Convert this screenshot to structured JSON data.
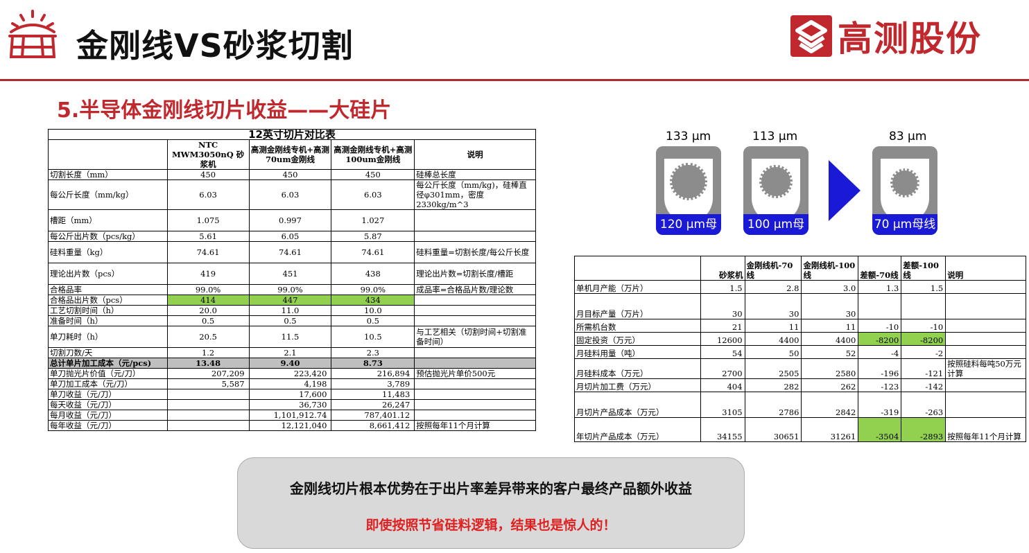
{
  "header": {
    "title": "金刚线VS砂浆切割",
    "company": "高测股份",
    "accent_color": "#c0282e",
    "logo_icon": "slide-deck-icon"
  },
  "subtitle": "5.半导体金刚线切片收益——大硅片",
  "left_table": {
    "title": "12英寸切片对比表",
    "headers": [
      "",
      "NTC MWM3050nQ 砂浆机",
      "高测金刚线专机+高测70um金刚线",
      "高测金刚线专机+高测100um金刚线",
      "说明"
    ],
    "rows": [
      [
        "切割长度（mm）",
        "450",
        "450",
        "450",
        "硅棒总长度"
      ],
      [
        "每公斤长度（mm/kg）",
        "6.03",
        "6.03",
        "6.03",
        "每公斤长度（mm/kg)，硅棒直径φ301mm，密度2330kg/m^3"
      ],
      [
        "槽距（mm）",
        "1.075",
        "0.997",
        "1.027",
        ""
      ],
      [
        "每公斤出片数（pcs/kg）",
        "5.61",
        "6.05",
        "5.87",
        ""
      ],
      [
        "硅料重量（kg）",
        "74.61",
        "74.61",
        "74.61",
        "硅料重量=切割长度/每公斤长度"
      ],
      [
        "理论出片数（pcs）",
        "419",
        "451",
        "438",
        "理论出片数=切割长度/槽距"
      ],
      [
        "合格品率",
        "99.0%",
        "99.0%",
        "99.0%",
        "成品率=合格品片数/理论数"
      ],
      [
        "合格品出片数（pcs）",
        "414",
        "447",
        "434",
        ""
      ],
      [
        "工艺切割时间（h）",
        "20.0",
        "11.0",
        "10.0",
        ""
      ],
      [
        "准备时间（h）",
        "0.5",
        "0.5",
        "0.5",
        ""
      ],
      [
        "单刀耗时（h）",
        "20.5",
        "11.5",
        "10.5",
        "与工艺相关（切割时间+切割准备时间）"
      ],
      [
        "切割刀数/天",
        "1.2",
        "2.1",
        "2.3",
        ""
      ],
      [
        "总计单片加工成本（元/pcs)",
        "13.48",
        "9.40",
        "8.73",
        ""
      ],
      [
        "单刀抛光片价值（元/刀）",
        "207,209",
        "223,420",
        "216,894",
        "预估抛光片单价500元"
      ],
      [
        "单刀加工成本（元/刀）",
        "5,587",
        "4,198",
        "3,789",
        ""
      ],
      [
        "单刀收益（元/刀）",
        "",
        "17,600",
        "11,483",
        ""
      ],
      [
        "每天收益（元/刀）",
        "",
        "36,730",
        "26,247",
        ""
      ],
      [
        "每月收益（元/刀）",
        "",
        "1,101,912.74",
        "787,401.12",
        ""
      ],
      [
        "每年收益（元/刀）",
        "",
        "12,121,040",
        "8,661,412",
        "按照每年11个月计算"
      ]
    ]
  },
  "diagram": {
    "dims": [
      "133 µm",
      "113 µm",
      "83 µm"
    ],
    "labels": [
      "120 µm母线",
      "100 µm母线",
      "70 µm母线"
    ],
    "band_color": "#1a1ad6"
  },
  "right_table": {
    "headers": [
      "",
      "砂浆机",
      "金刚线机-70线",
      "金刚线机-100线",
      "差额-70线",
      "差额-100线",
      "说明"
    ],
    "rows": [
      [
        "单机月产能（万片）",
        "1.5",
        "2.8",
        "3.0",
        "1.3",
        "1.5",
        ""
      ],
      [
        "月目标产量（万片）",
        "30",
        "30",
        "30",
        "",
        "",
        ""
      ],
      [
        "所需机台数",
        "21",
        "11",
        "11",
        "-10",
        "-10",
        ""
      ],
      [
        "固定投资（万元）",
        "12600",
        "4400",
        "4400",
        "-8200",
        "-8200",
        ""
      ],
      [
        "月硅料用量（吨）",
        "54",
        "50",
        "52",
        "-4",
        "-2",
        ""
      ],
      [
        "月硅料成本（万元）",
        "2700",
        "2505",
        "2580",
        "-196",
        "-121",
        "按照硅料每吨50万元计算"
      ],
      [
        "月切片加工费（万元）",
        "404",
        "282",
        "262",
        "-123",
        "-142",
        ""
      ],
      [
        "月切片产品成本（万元）",
        "3105",
        "2786",
        "2842",
        "-319",
        "-263",
        ""
      ],
      [
        "年切片产品成本（万元）",
        "34155",
        "30651",
        "31261",
        "-3504",
        "-2893",
        "按照每年11个月计算"
      ]
    ]
  },
  "note": {
    "line1": "金刚线切片根本优势在于出片率差异带来的客户最终产品额外收益",
    "line2": "即使按照节省硅料逻辑，结果也是惊人的！"
  }
}
